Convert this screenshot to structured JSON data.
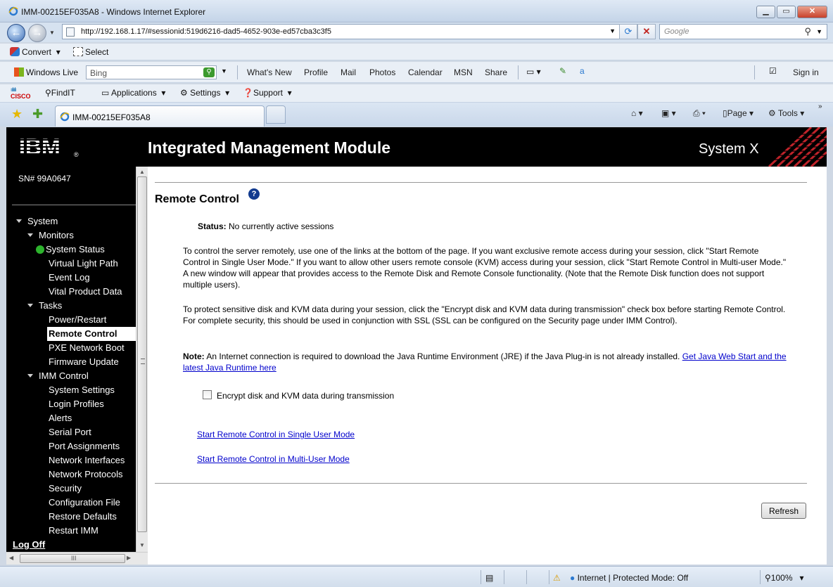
{
  "window": {
    "title": "IMM-00215EF035A8 - Windows Internet Explorer"
  },
  "address": {
    "url": "http://192.168.1.17/#sessionid:519d6216-dad5-4652-903e-ed57cba3c3f5"
  },
  "search": {
    "placeholder": "Google"
  },
  "command_bar": {
    "convert": "Convert",
    "select": "Select"
  },
  "live_bar": {
    "windows_live": "Windows Live",
    "bing_placeholder": "Bing",
    "links": [
      "What's New",
      "Profile",
      "Mail",
      "Photos",
      "Calendar",
      "MSN",
      "Share"
    ],
    "sign_in": "Sign in"
  },
  "cisco_bar": {
    "findit": "FindIT",
    "applications": "Applications",
    "settings": "Settings",
    "support": "Support",
    "logo_text": "CISCO"
  },
  "tabs": {
    "active": "IMM-00215EF035A8"
  },
  "tab_commands": {
    "page": "Page",
    "tools": "Tools"
  },
  "header": {
    "brand": "IBM",
    "title": "Integrated Management Module",
    "product": "System X"
  },
  "sidebar": {
    "serial": "SN# 99A0647",
    "system": "System",
    "monitors": "Monitors",
    "monitor_items": [
      "System Status",
      "Virtual Light Path",
      "Event Log",
      "Vital Product Data"
    ],
    "tasks": "Tasks",
    "task_items": [
      "Power/Restart",
      "Remote Control",
      "PXE Network Boot",
      "Firmware Update"
    ],
    "imm_control": "IMM Control",
    "imm_items": [
      "System Settings",
      "Login Profiles",
      "Alerts",
      "Serial Port",
      "Port Assignments",
      "Network Interfaces",
      "Network Protocols",
      "Security",
      "Configuration File",
      "Restore Defaults",
      "Restart IMM"
    ],
    "log_off": "Log Off",
    "active_item": "Remote Control"
  },
  "main": {
    "heading": "Remote Control",
    "status_label": "Status:",
    "status_value": "No currently active sessions",
    "para1": "To control the server remotely, use one of the links at the bottom of the page. If you want exclusive remote access during your session, click \"Start Remote Control in Single User Mode.\" If you want to allow other users remote console (KVM) access during your session, click \"Start Remote Control in Multi-user Mode.\" A new window will appear that provides access to the Remote Disk and Remote Console functionality. (Note that the Remote Disk function does not support multiple users).",
    "para2": "To protect sensitive disk and KVM data during your session, click the \"Encrypt disk and KVM data during transmission\" check box before starting Remote Control. For complete security, this should be used in conjunction with SSL (SSL can be configured on the Security page under IMM Control).",
    "note_label": "Note:",
    "note_text": "An Internet connection is required to download the Java Runtime Environment (JRE) if the Java Plug-in is not already installed.",
    "note_link": "Get Java Web Start and the latest Java Runtime here",
    "encrypt_label": "Encrypt disk and KVM data during transmission",
    "encrypt_checked": false,
    "link_single": "Start Remote Control in Single User Mode",
    "link_multi": "Start Remote Control in Multi-User Mode",
    "refresh": "Refresh"
  },
  "statusbar": {
    "zone": "Internet | Protected Mode: Off",
    "zoom": "100%"
  }
}
